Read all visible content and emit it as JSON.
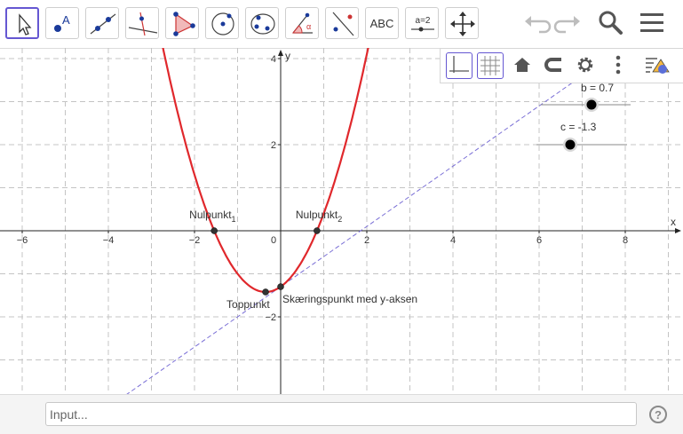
{
  "toolbar": {
    "tools": [
      {
        "id": "move",
        "icon": "move-pointer-icon"
      },
      {
        "id": "point",
        "icon": "point-icon",
        "label": "A"
      },
      {
        "id": "line",
        "icon": "line-icon"
      },
      {
        "id": "perpendicular",
        "icon": "perpendicular-line-icon"
      },
      {
        "id": "polygon",
        "icon": "polygon-icon"
      },
      {
        "id": "circle",
        "icon": "circle-center-point-icon"
      },
      {
        "id": "conic",
        "icon": "conic-icon"
      },
      {
        "id": "angle",
        "icon": "angle-icon"
      },
      {
        "id": "reflect",
        "icon": "reflect-about-line-icon"
      },
      {
        "id": "text",
        "icon": "text-icon",
        "label": "ABC"
      },
      {
        "id": "slider",
        "icon": "slider-icon",
        "label": "a=2"
      },
      {
        "id": "move-view",
        "icon": "move-graphics-view-icon"
      }
    ]
  },
  "graphics": {
    "axes": {
      "x_label": "x",
      "y_label": "y",
      "x_ticks": [
        "−6",
        "−4",
        "−2",
        "0",
        "2",
        "4",
        "6",
        "8"
      ],
      "y_ticks": [
        "4",
        "2",
        "−2"
      ]
    },
    "points": {
      "nulpunkt1": {
        "label": "Nulpunkt",
        "sub": "1"
      },
      "nulpunkt2": {
        "label": "Nulpunkt",
        "sub": "2"
      },
      "toppunkt": {
        "label": "Toppunkt"
      },
      "skaering": {
        "label": "Skæringspunkt med y-aksen"
      }
    },
    "sliders": {
      "b": {
        "label": "b = 0.7",
        "value": 0.7
      },
      "c": {
        "label": "c = -1.3",
        "value": -1.3
      }
    },
    "colors": {
      "curve": "#e0282c",
      "tangent": "#7a6fd6",
      "accent": "#6557d2"
    }
  },
  "input": {
    "placeholder": "Input..."
  },
  "help": {
    "label": "?"
  }
}
